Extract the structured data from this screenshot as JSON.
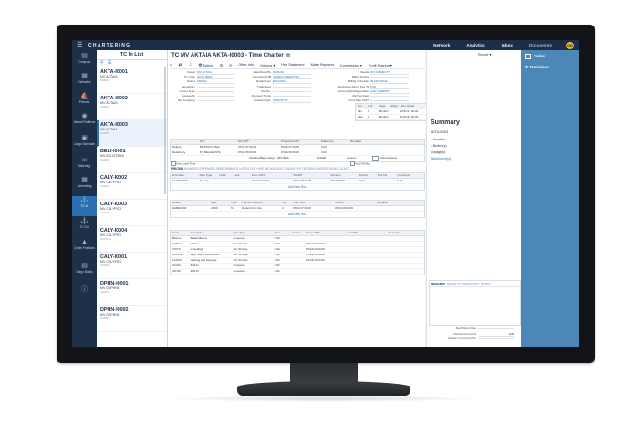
{
  "app": {
    "brand": "CHARTERING",
    "nav": [
      "Network",
      "Analytics",
      "Inbox",
      "Documents"
    ],
    "avatar": "GB"
  },
  "rail": [
    "Compose",
    "Estimates",
    "Pictures",
    "Market Positions",
    "Cargo Schedule",
    "Matching",
    "Scheduling",
    "TC In",
    "TC Out",
    "Crude Positions",
    "Cargo Books",
    ""
  ],
  "list": {
    "title": "TC In List",
    "items": [
      {
        "code": "AKTA-I0001",
        "vessel": "MV AKTAIA",
        "status": "VEDEN"
      },
      {
        "code": "AKTA-I0002",
        "vessel": "MV AKTAIA",
        "status": "VEDEN"
      },
      {
        "code": "AKTA-I0003",
        "vessel": "MV AKTAIA",
        "status": "VEDEN"
      },
      {
        "code": "BELI-I0001",
        "vessel": "MV BELISTARA",
        "status": "VEDEN"
      },
      {
        "code": "CALY-I0002",
        "vessel": "MV CALYPSO",
        "status": "VEDEN"
      },
      {
        "code": "CALY-I0003",
        "vessel": "MV CALYPSO",
        "status": "VEDEN"
      },
      {
        "code": "CALY-I0004",
        "vessel": "MV CALYPSO",
        "status": "KLPSNA"
      },
      {
        "code": "CALY-I0001",
        "vessel": "MV CALYPSO",
        "status": "VEDEN"
      },
      {
        "code": "DPHN-I0001",
        "vessel": "MV DAPHNE",
        "status": "VEDEN"
      },
      {
        "code": "DPHN-I0002",
        "vessel": "MV DAPHNE",
        "status": "VEDEN"
      }
    ]
  },
  "main": {
    "title": "TC MV AKTAIA AKTA-I0003 - Time Charter In",
    "toolbar": [
      "Delete",
      "Other Info",
      "Options",
      "Hire Statement",
      "Make Payment",
      "Commission",
      "Profit Sharing",
      "Report"
    ],
    "left_fields": [
      {
        "label": "Vessel",
        "value": "MV AKTAIA"
      },
      {
        "label": "TC Code",
        "value": "AKTA-I0003"
      },
      {
        "label": "Owner",
        "value": "VEDEN"
      },
      {
        "label": "Beneficiary",
        "value": ""
      },
      {
        "label": "Lessor From",
        "value": ""
      },
      {
        "label": "Lessee To",
        "value": ""
      },
      {
        "label": "Ref Company",
        "value": ""
      }
    ],
    "mid_fields": [
      {
        "label": "Date/Fixed By",
        "value": "05/30/16"
      },
      {
        "label": "Company/LOB",
        "value": "VEDEN  OPERATING"
      },
      {
        "label": "Department",
        "value": "BULKMAX"
      },
      {
        "label": "Trade Area",
        "value": ""
      },
      {
        "label": "Ref No.",
        "value": ""
      },
      {
        "label": "Payment Terms",
        "value": ""
      },
      {
        "label": "Contract Type",
        "value": "PERIOD TC"
      }
    ],
    "right_fields": [
      {
        "label": "Status",
        "value": "ON SUBJECTS"
      },
      {
        "label": "Billing Period",
        "value": ""
      },
      {
        "label": "Billing Schedule",
        "value": "IN ADVANCE"
      },
      {
        "label": "Reclocate Admin Fee %",
        "value": "0.00"
      },
      {
        "label": "Currency/Exchange Rate",
        "value": "USD  1.000000"
      },
      {
        "label": "Ref Contract",
        "value": ""
      },
      {
        "label": "Conf Date GMT",
        "value": ""
      }
    ],
    "duration": {
      "headers": [
        "Dur",
        "Unit",
        "Days",
        "+Days",
        "Est. Redel"
      ],
      "rows": [
        {
          "label": "Min",
          "dur": "6",
          "unit": "Months",
          "date": "12/31/17 00:00"
        },
        {
          "label": "Max",
          "dur": "9",
          "unit": "Months",
          "date": "01/31/18 00:00"
        }
      ]
    },
    "delivery": {
      "headers": [
        "Port",
        "Est GMT",
        "Projected GMT",
        "Difference",
        "Remarks"
      ],
      "rows": [
        {
          "name": "Delivery",
          "port": "BOSTON (USA)",
          "est": "07/21/17 00:00",
          "diff": "0.00"
        },
        {
          "name": "Redelivery",
          "port": "NY BELLEVISTA",
          "est": "07/21/18 00:00",
          "diff": "0.00"
        }
      ],
      "duration_label": "Duration/Basis (days)",
      "duration_value": "365.0000",
      "basis_value": "0.0000",
      "basis_type": "Custom",
      "intercompany": "Intercompany",
      "ic_company": "IC Company",
      "ic_adj": "IC Adj %",
      "use_local_time": "Use Local Time",
      "add_off_hire": "Add Off Hire"
    },
    "tabs1": [
      "PRICING",
      "BUNKERS",
      "EXPENSES",
      "PERFORMANCE",
      "NOTES",
      "OFF HIRE",
      "BROKERAGE",
      "TRANSFERS",
      "OPTIONS",
      "LINKED TRADES",
      "LEASE"
    ],
    "hire": {
      "headers": [
        "Hire Rate",
        "Rate Type",
        "Code",
        "Lock",
        "From GMT",
        "To GMT",
        "Duration",
        "Period",
        "TCL Ins",
        "Comments"
      ],
      "rows": [
        [
          "13,000.0000",
          "Per day",
          "",
          "",
          "07/21/17 00:00",
          "07/21/18 00:00",
          "364.000000",
          "Days",
          "",
          "0.00"
        ]
      ],
      "add": "Add New Row"
    },
    "broker": {
      "headers": [
        "Broker",
        "Rate",
        "Type",
        "Payment Method",
        "TR",
        "From GMT",
        "To GMT",
        "Remarks"
      ],
      "rows": [
        [
          "DABECOM",
          "2.500",
          "%",
          "Deduct from hire",
          "2",
          "07/21/17 00:00",
          "07/21/18 00:00",
          ""
        ]
      ],
      "add": "Add New Row"
    },
    "expenses": {
      "headers": [
        "Code",
        "Description",
        "Rate Type",
        "Rate",
        "Comm",
        "From GMT",
        "To GMT",
        "Remarks"
      ],
      "rows": [
        [
          "BALLA",
          "Ballast Bonus",
          "Lumpsum",
          "0.00",
          "",
          "",
          "",
          ""
        ],
        [
          "CABLE",
          "Cables",
          "Per 30 days",
          "0.00",
          "",
          "07/21/17 00:00",
          "",
          ""
        ],
        [
          "VICTU",
          "Victualling",
          "Per 30 days",
          "0.00",
          "",
          "07/21/17 00:00",
          "",
          ""
        ],
        [
          "ALLOW",
          "Repr. Exp. / Allowances",
          "Per 30 days",
          "0.00",
          "",
          "07/21/17 00:00",
          "",
          ""
        ],
        [
          "LASHS",
          "Lashing and Stowage",
          "Per 30 days",
          "0.00",
          "",
          "07/21/17 00:00",
          "",
          ""
        ],
        [
          "ILOHC",
          "ILOHC",
          "Lumpsum",
          "0.00",
          "",
          "",
          "",
          ""
        ],
        [
          "IHTHC",
          "IHTHC",
          "Lumpsum",
          "0.00",
          "",
          "",
          "",
          ""
        ]
      ]
    }
  },
  "summary": {
    "title": "Summary",
    "code": "AKTA-I0003",
    "links": [
      "Invoices",
      "Broker(s)",
      "Voyage(s)",
      "Attachment(s)"
    ],
    "remarks_tabs": [
      "REMARKS",
      "NOTES TO OPERATIONS",
      "NOTES"
    ],
    "hire_fields": [
      {
        "label": "Next Open Date",
        "value": ""
      },
      {
        "label": "Owner's Comm %",
        "value": "0.00"
      },
      {
        "label": "Owner's Comm For To",
        "value": ""
      }
    ]
  },
  "tasks": {
    "items": [
      "Tasks",
      "Revisions"
    ]
  }
}
